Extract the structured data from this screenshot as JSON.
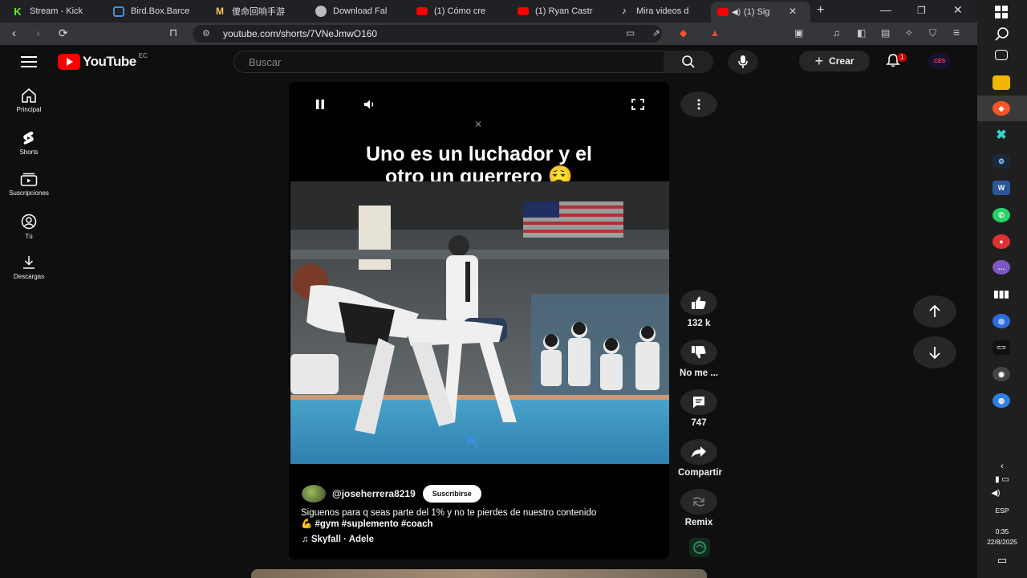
{
  "browser": {
    "tabs": [
      {
        "label": "Stream - Kick",
        "fav_letter": "K",
        "fav_color": "#53fc18"
      },
      {
        "label": "Bird.Box.Barce",
        "fav_letter": "",
        "fav_color": "#4a8fd8"
      },
      {
        "label": "傻命回响手游",
        "fav_letter": "M",
        "fav_color": "#f2c94c"
      },
      {
        "label": "Download Fal",
        "fav_letter": "",
        "fav_color": "#bbbbbb"
      },
      {
        "label": "(1) Cómo cre",
        "fav_letter": "",
        "fav_color": "#ff0000"
      },
      {
        "label": "(1) Ryan Castr",
        "fav_letter": "",
        "fav_color": "#ff0000"
      },
      {
        "label": "Mira videos d",
        "fav_letter": "",
        "fav_color": "#ffffff"
      },
      {
        "label": "(1) Sig",
        "fav_letter": "",
        "fav_color": "#ff0000"
      }
    ],
    "url": "youtube.com/shorts/7VNeJmwO160"
  },
  "youtube": {
    "logo_text": "YouTube",
    "country": "EC",
    "search_placeholder": "Buscar",
    "create_label": "Crear",
    "notifications": "1",
    "avatar_text": "CES",
    "sidebar": [
      {
        "label": "Principal",
        "icon": "home-icon"
      },
      {
        "label": "Shorts",
        "icon": "shorts-icon"
      },
      {
        "label": "Suscripciones",
        "icon": "subscriptions-icon"
      },
      {
        "label": "Tú",
        "icon": "you-icon"
      },
      {
        "label": "Descargas",
        "icon": "download-icon"
      }
    ]
  },
  "short": {
    "caption_line1": "Uno es un luchador y el",
    "caption_line2": "otro un guerrero 😮‍💨",
    "channel": "@joseherrera8219",
    "subscribe_label": "Suscribirse",
    "description": "Siguenos para q seas parte del 1% y no te pierdes de nuestro contenido",
    "hashtags": "💪 #gym #suplemento #coach",
    "music": "Skyfall · Adele"
  },
  "actions": {
    "likes": "132 k",
    "dislike_label": "No me ...",
    "comments": "747",
    "share_label": "Compartir",
    "remix_label": "Remix"
  },
  "taskbar": {
    "lang": "ESP",
    "time": "0:35",
    "date": "22/8/2025"
  }
}
